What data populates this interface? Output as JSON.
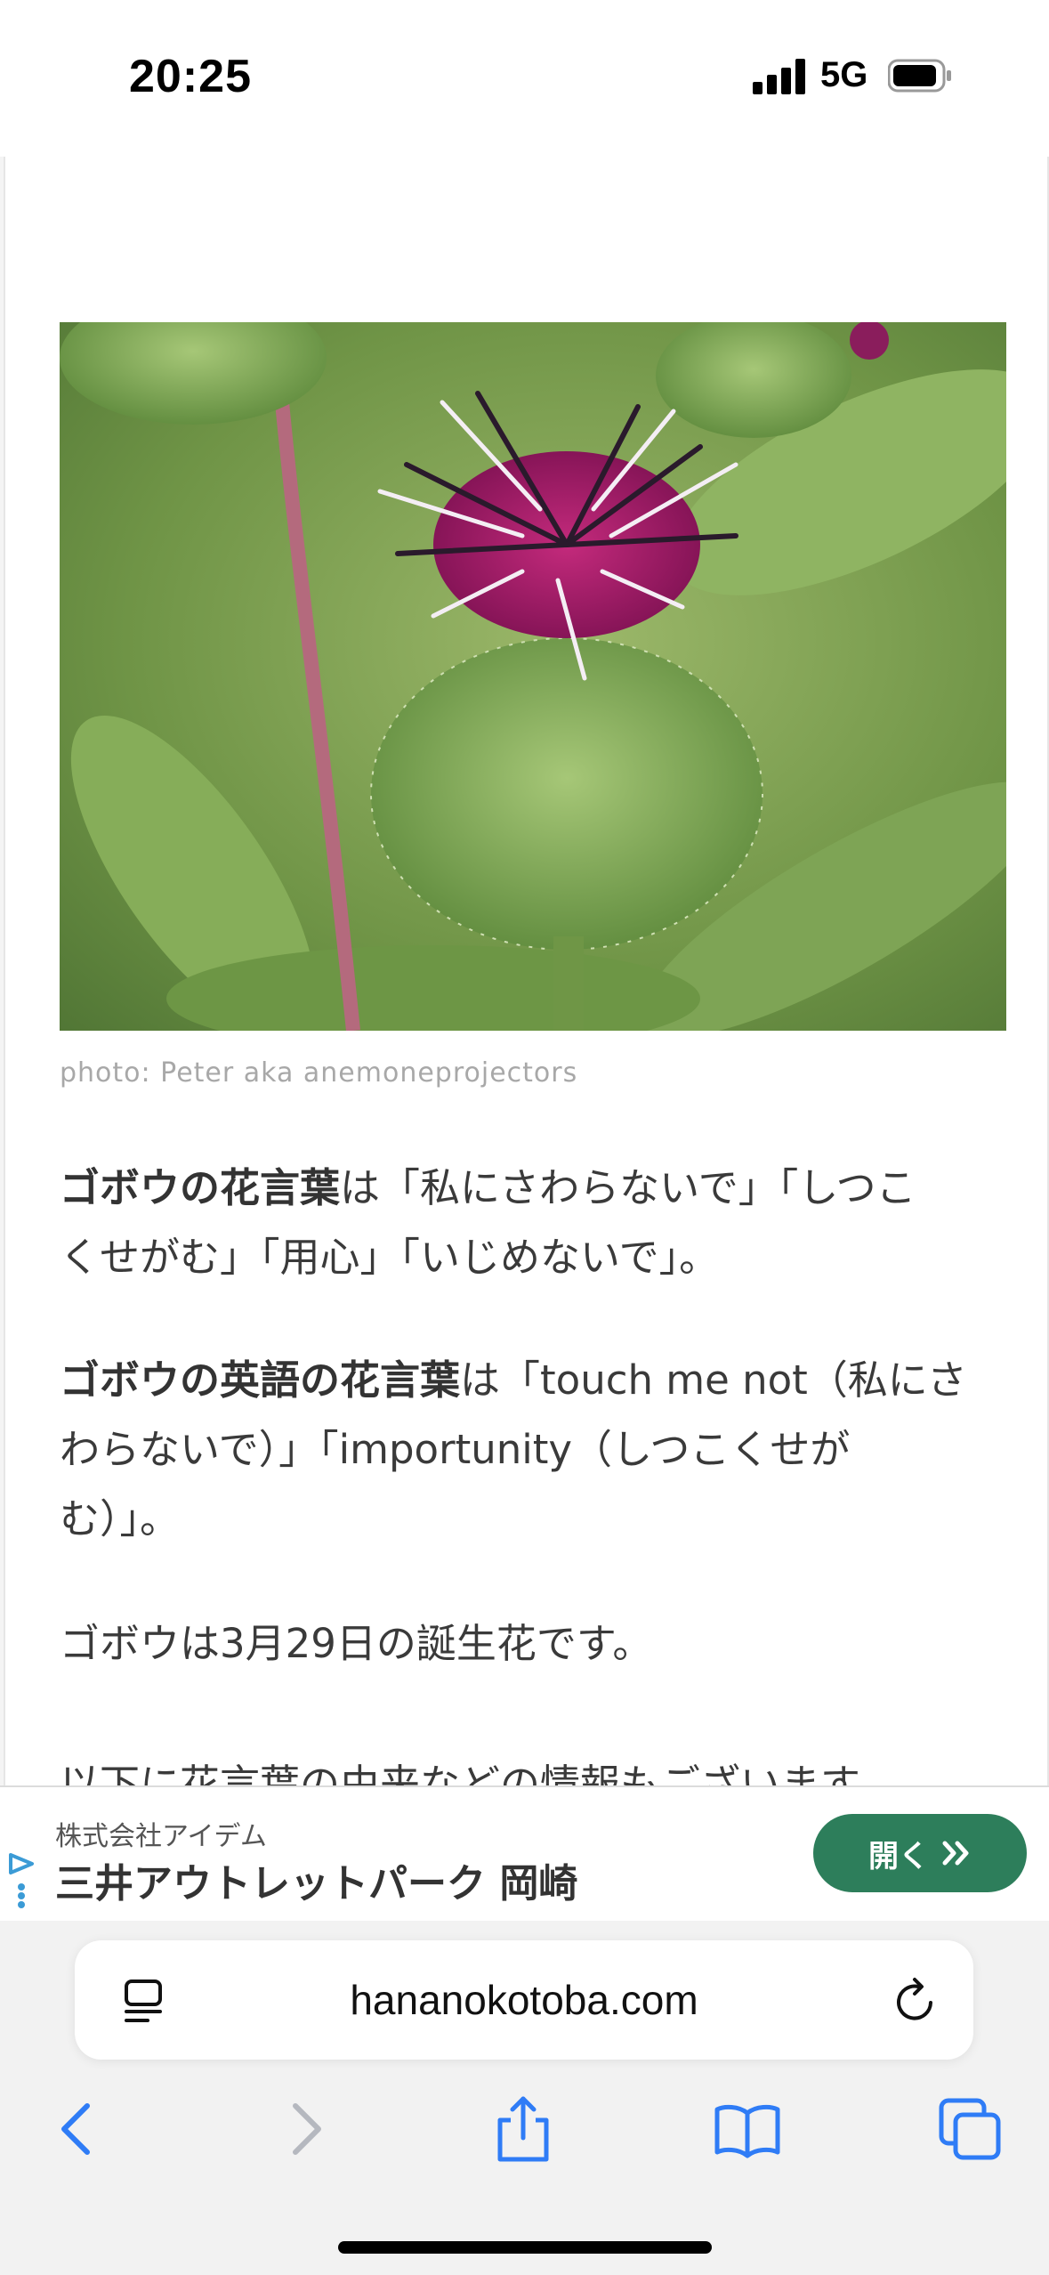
{
  "status_bar": {
    "time": "20:25",
    "network": "5G",
    "icons": [
      "signal-bars-icon",
      "battery-icon"
    ]
  },
  "article": {
    "photo_caption": "photo: Peter aka anemoneprojectors",
    "p1_bold": "ゴボウの花言葉",
    "p1_line1_rest": "は「私にさわらないで」「しつこ",
    "p1_line2": "くせがむ」「用心」「いじめないで」。",
    "p2_bold": "ゴボウの英語の花言葉",
    "p2_line1_rest": "は「touch me not（私にさ",
    "p2_line2": "わらないで）」「importunity（しつこくせが",
    "p2_line3": "む）」。",
    "p3": "ゴボウは3月29日の誕生花です。",
    "p4": "以下に花言葉の由来などの情報もございます。"
  },
  "ad": {
    "company": "株式会社アイデム",
    "title": "三井アウトレットパーク 岡崎",
    "open_label": "開く",
    "open_icon": "double-chevron-right-icon",
    "colors": {
      "button": "#2d7e5b"
    }
  },
  "browser": {
    "url": "hananokotoba.com",
    "icons": [
      "reader-icon",
      "reload-icon",
      "back-icon",
      "forward-icon",
      "share-icon",
      "bookmarks-icon",
      "tabs-icon"
    ],
    "colors": {
      "accent": "#2f7cf6"
    }
  }
}
